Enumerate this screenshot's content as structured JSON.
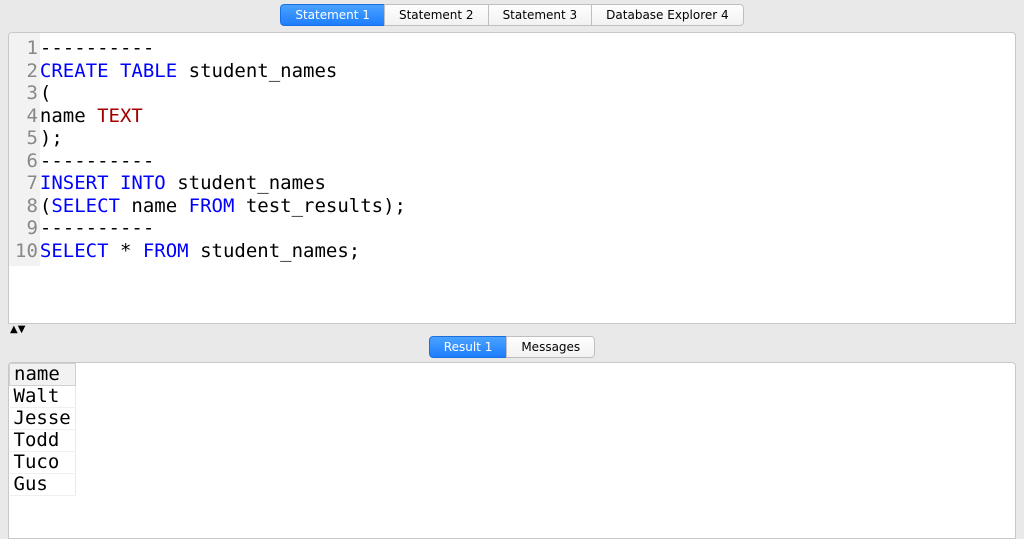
{
  "top_tabs": [
    {
      "label": "Statement 1",
      "active": true
    },
    {
      "label": "Statement 2",
      "active": false
    },
    {
      "label": "Statement 3",
      "active": false
    },
    {
      "label": "Database Explorer 4",
      "active": false
    }
  ],
  "editor_lines": [
    {
      "n": "1",
      "tokens": [
        {
          "t": "----------",
          "c": "com"
        }
      ]
    },
    {
      "n": "2",
      "tokens": [
        {
          "t": "CREATE",
          "c": "kw"
        },
        {
          "t": " "
        },
        {
          "t": "TABLE",
          "c": "kw"
        },
        {
          "t": " student_names"
        }
      ]
    },
    {
      "n": "3",
      "tokens": [
        {
          "t": "("
        }
      ]
    },
    {
      "n": "4",
      "tokens": [
        {
          "t": "name "
        },
        {
          "t": "TEXT",
          "c": "typ"
        }
      ]
    },
    {
      "n": "5",
      "tokens": [
        {
          "t": ");"
        }
      ]
    },
    {
      "n": "6",
      "tokens": [
        {
          "t": "----------",
          "c": "com"
        }
      ]
    },
    {
      "n": "7",
      "tokens": [
        {
          "t": "INSERT",
          "c": "kw"
        },
        {
          "t": " "
        },
        {
          "t": "INTO",
          "c": "kw"
        },
        {
          "t": " student_names"
        }
      ]
    },
    {
      "n": "8",
      "tokens": [
        {
          "t": "("
        },
        {
          "t": "SELECT",
          "c": "kw"
        },
        {
          "t": " name "
        },
        {
          "t": "FROM",
          "c": "kw"
        },
        {
          "t": " test_results);"
        }
      ]
    },
    {
      "n": "9",
      "tokens": [
        {
          "t": "----------",
          "c": "com"
        }
      ]
    },
    {
      "n": "10",
      "tokens": [
        {
          "t": "SELECT",
          "c": "kw"
        },
        {
          "t": " * "
        },
        {
          "t": "FROM",
          "c": "kw"
        },
        {
          "t": " student_names;"
        }
      ]
    }
  ],
  "splitter_glyph": "▲▼",
  "result_tabs": [
    {
      "label": "Result 1",
      "active": true
    },
    {
      "label": "Messages",
      "active": false
    }
  ],
  "result_columns": [
    "name"
  ],
  "result_rows": [
    [
      "Walt"
    ],
    [
      "Jesse"
    ],
    [
      "Todd"
    ],
    [
      "Tuco"
    ],
    [
      "Gus"
    ]
  ]
}
